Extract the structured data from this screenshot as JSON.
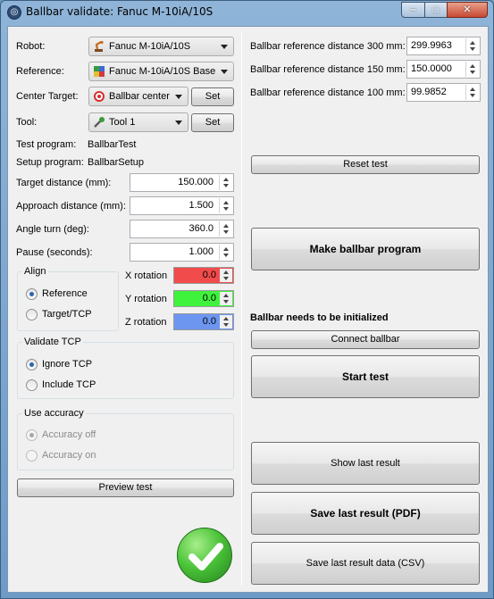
{
  "window": {
    "title": "Ballbar validate: Fanuc M-10iA/10S",
    "min_glyph": "–",
    "max_glyph": "□",
    "close_glyph": "✕"
  },
  "left": {
    "robot_label": "Robot:",
    "robot_value": "Fanuc M-10iA/10S",
    "reference_label": "Reference:",
    "reference_value": "Fanuc M-10iA/10S Base",
    "center_label": "Center Target:",
    "center_value": "Ballbar center",
    "tool_label": "Tool:",
    "tool_value": "Tool 1",
    "set_label": "Set",
    "test_program_label": "Test program:",
    "test_program_value": "BallbarTest",
    "setup_program_label": "Setup program:",
    "setup_program_value": "BallbarSetup",
    "target_distance_label": "Target distance (mm):",
    "target_distance_value": "150.000",
    "approach_distance_label": "Approach distance (mm):",
    "approach_distance_value": "1.500",
    "angle_turn_label": "Angle turn (deg):",
    "angle_turn_value": "360.0",
    "pause_label": "Pause (seconds):",
    "pause_value": "1.000",
    "align": {
      "title": "Align",
      "reference": "Reference",
      "target_tcp": "Target/TCP"
    },
    "rotations": {
      "x_label": "X rotation",
      "x_value": "0.0",
      "x_color": "#f24b4b",
      "y_label": "Y rotation",
      "y_value": "0.0",
      "y_color": "#3ff23c",
      "z_label": "Z rotation",
      "z_value": "0.0",
      "z_color": "#6c96f0"
    },
    "validate_tcp": {
      "title": "Validate TCP",
      "ignore": "Ignore TCP",
      "include": "Include TCP"
    },
    "use_accuracy": {
      "title": "Use accuracy",
      "off": "Accuracy off",
      "on": "Accuracy on"
    },
    "preview_button": "Preview test"
  },
  "right": {
    "ref300_label": "Ballbar reference distance 300 mm:",
    "ref300_value": "299.9963",
    "ref150_label": "Ballbar reference distance 150 mm:",
    "ref150_value": "150.0000",
    "ref100_label": "Ballbar reference distance 100 mm:",
    "ref100_value": "99.9852",
    "reset_button": "Reset test",
    "make_program_button": "Make ballbar program",
    "status_text": "Ballbar needs to be initialized",
    "connect_button": "Connect ballbar",
    "start_button": "Start test",
    "show_result_button": "Show last result",
    "save_pdf_button": "Save last result (PDF)",
    "save_csv_button": "Save last result data (CSV)"
  },
  "status_icon": "checkmark-ok-icon",
  "colors": {
    "ok_green": "#4cc43a",
    "titlebar_blue": "#8fb4d8",
    "close_red": "#c74a34"
  }
}
